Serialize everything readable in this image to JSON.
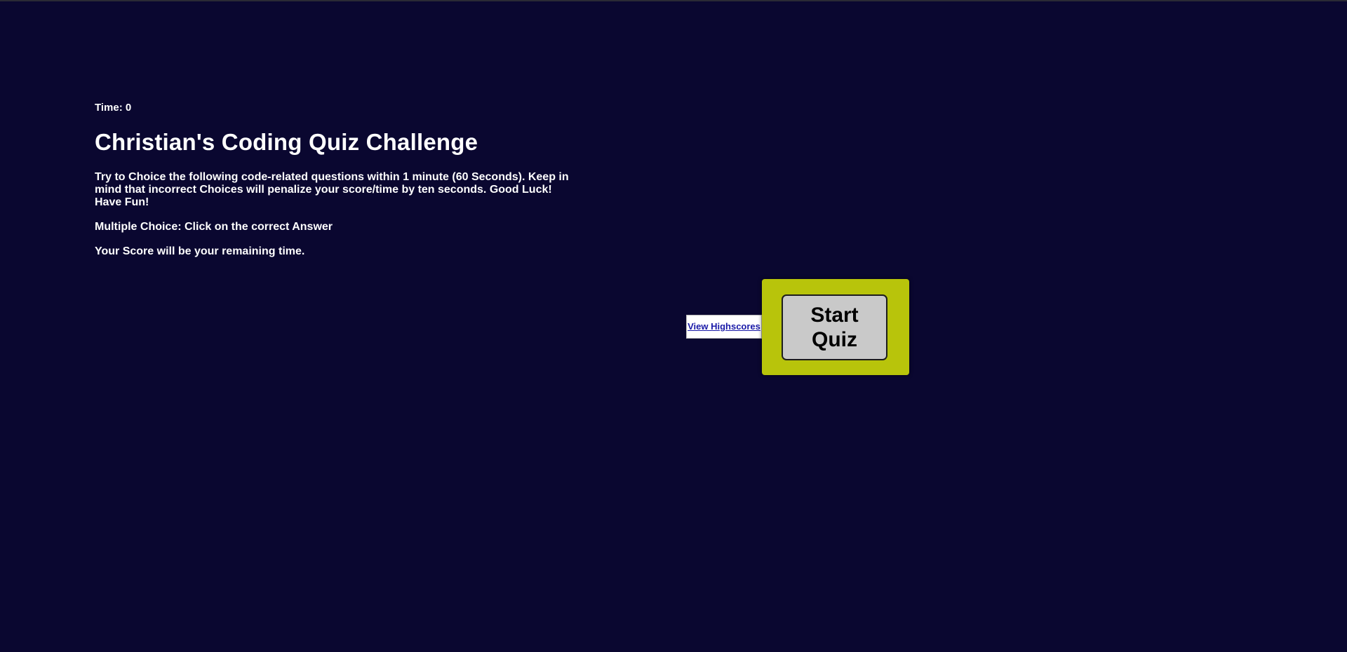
{
  "timer": {
    "label": "Time: 0"
  },
  "intro": {
    "title": "Christian's Coding Quiz Challenge",
    "instructions": "Try to Choice the following code-related questions within 1 minute (60 Seconds). Keep in mind that incorrect Choices will penalize your score/time by ten seconds. Good Luck! Have Fun!",
    "format_note": "Multiple Choice: Click on the correct Answer",
    "score_note": "Your Score will be your remaining time."
  },
  "actions": {
    "view_highscores_label": "View Highscores",
    "start_quiz_label": "Start Quiz"
  },
  "colors": {
    "background": "#0a0730",
    "start_frame": "#b8c40b",
    "start_button": "#c9c9c9",
    "link": "#1a1aa8"
  }
}
